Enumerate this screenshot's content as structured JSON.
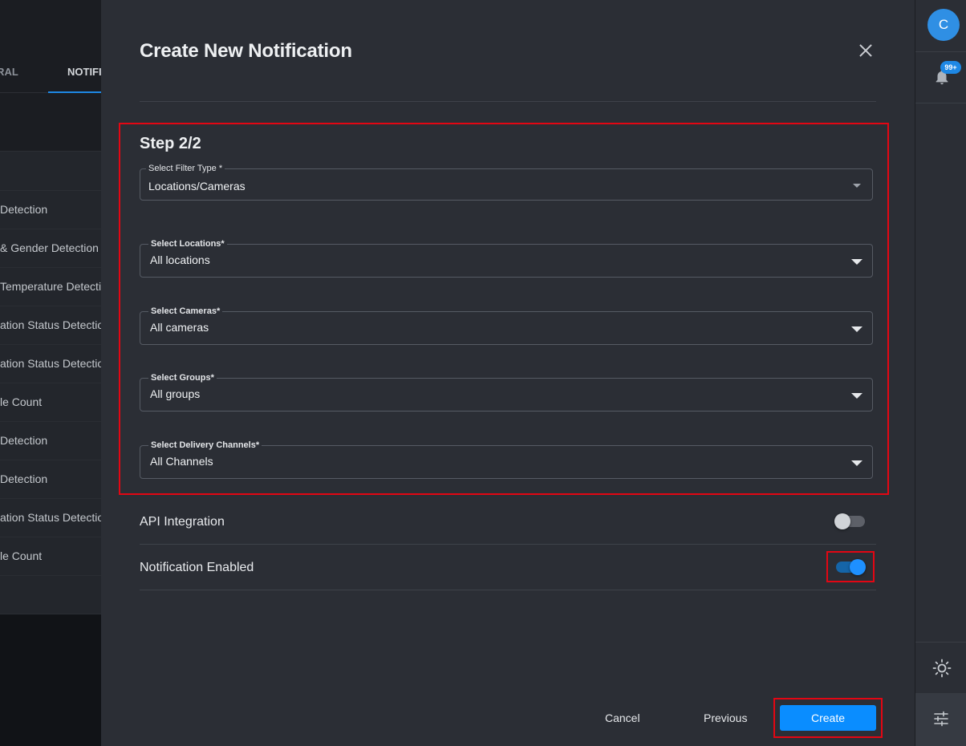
{
  "background": {
    "tabs": [
      "NERAL",
      "NOTIFI"
    ],
    "rows": [
      "Detection",
      "& Gender Detection",
      " Temperature Detection",
      "ation Status Detection",
      "ation Status Detection",
      "le Count",
      "Detection",
      "Detection",
      "ation Status Detection",
      "le Count"
    ]
  },
  "modal": {
    "title": "Create New Notification",
    "step": "Step 2/2",
    "filter_type": {
      "label": "Select Filter Type *",
      "value": "Locations/Cameras"
    },
    "locations": {
      "label": "Select Locations*",
      "value": "All locations"
    },
    "cameras": {
      "label": "Select Cameras*",
      "value": "All cameras"
    },
    "groups": {
      "label": "Select Groups*",
      "value": "All groups"
    },
    "channels": {
      "label": "Select Delivery Channels*",
      "value": "All Channels"
    },
    "api_integration": {
      "label": "API Integration",
      "enabled": false
    },
    "notification_enabled": {
      "label": "Notification Enabled",
      "enabled": true
    },
    "buttons": {
      "cancel": "Cancel",
      "previous": "Previous",
      "create": "Create"
    }
  },
  "rail": {
    "avatar_initial": "C",
    "notification_badge": "99+",
    "icons": [
      "bell-icon",
      "sun-icon",
      "sliders-icon"
    ]
  },
  "colors": {
    "accent": "#0a8dff",
    "highlight": "#e30613",
    "panel": "#2b2e35"
  }
}
